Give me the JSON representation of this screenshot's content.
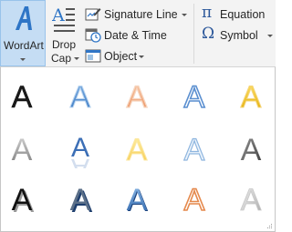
{
  "ribbon": {
    "wordart": {
      "label": "WordArt",
      "icon": "wordart-icon"
    },
    "dropcap": {
      "line1": "Drop",
      "line2": "Cap",
      "icon": "drop-cap-icon"
    },
    "signature_line": {
      "label": "Signature Line",
      "icon": "signature-line-icon"
    },
    "date_time": {
      "label": "Date & Time",
      "icon": "calendar-clock-icon"
    },
    "object": {
      "label": "Object",
      "icon": "object-icon"
    },
    "equation": {
      "glyph": "π",
      "label": "Equation"
    },
    "symbol": {
      "glyph": "Ω",
      "label": "Symbol"
    }
  },
  "gallery": {
    "rows": [
      [
        "fill-black-text",
        "fill-blue-accent",
        "fill-orange-accent",
        "fill-white-outline-blue",
        "fill-gold-accent"
      ],
      [
        "gradient-gray",
        "fill-blue-reflection",
        "fill-gold-soft",
        "fill-white-outline-light-blue",
        "gradient-dark-gray"
      ],
      [
        "fill-black-shadow",
        "fill-gray-shadow",
        "fill-blue-bevel",
        "fill-white-outline-orange",
        "fill-silver-bevel"
      ]
    ],
    "colors": {
      "highlight": "#c5ddf4",
      "blue": "#4f81bd",
      "orange": "#f0a37a",
      "gold": "#f2c200"
    }
  }
}
